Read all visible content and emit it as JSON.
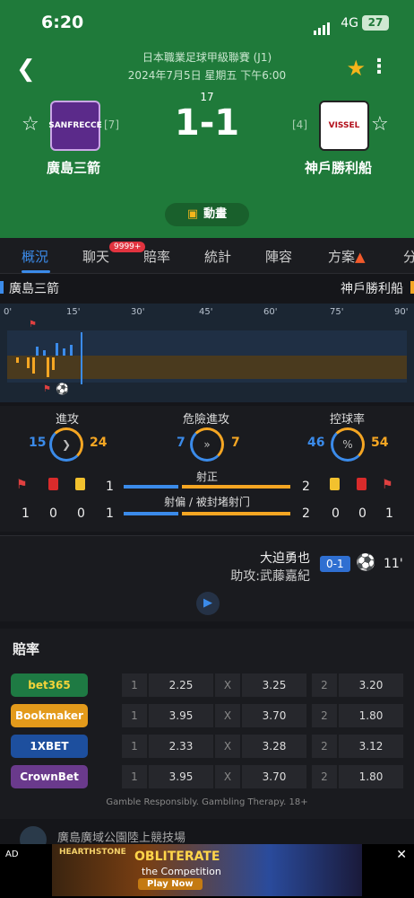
{
  "status": {
    "time": "6:20",
    "network": "4G",
    "battery": "27"
  },
  "header": {
    "league": "日本職業足球甲級聯賽 (J1)",
    "datetime": "2024年7月5日 星期五 下午6:00",
    "round": "17",
    "score": "1-1",
    "home": {
      "name": "廣島三箭",
      "rank": "[7]",
      "logo_text": "SANFRECCE"
    },
    "away": {
      "name": "神戶勝利船",
      "rank": "[4]",
      "logo_text": "VISSEL"
    },
    "animation_label": "動畫",
    "icons": {
      "back": "chevron-left-icon",
      "favorite": "star-icon",
      "more": "more-vertical-icon"
    }
  },
  "tabs": [
    {
      "label": "概況"
    },
    {
      "label": "聊天"
    },
    {
      "label": "賠率"
    },
    {
      "label": "統計"
    },
    {
      "label": "陣容"
    },
    {
      "label": "方案"
    },
    {
      "label": "分"
    }
  ],
  "chat_badge": "9999+",
  "timeline": {
    "home_name": "廣島三箭",
    "away_name": "神戶勝利船",
    "ticks": [
      "0'",
      "15'",
      "30'",
      "45'",
      "60'",
      "75'",
      "90'"
    ]
  },
  "stats": {
    "attack": {
      "label": "進攻",
      "home": "15",
      "away": "24"
    },
    "dangerous": {
      "label": "危險進攻",
      "home": "7",
      "away": "7"
    },
    "possession": {
      "label": "控球率",
      "home": "46",
      "away": "54"
    },
    "home_cards": {
      "corners": "1",
      "red": "0",
      "yellow": "0"
    },
    "away_cards": {
      "corners": "1",
      "red": "0",
      "yellow": "0"
    },
    "shots_on": {
      "label": "射正",
      "home": "1",
      "away": "2"
    },
    "shots_off": {
      "label": "射偏 / 被封堵射门",
      "home": "1",
      "away": "2"
    }
  },
  "goal_event": {
    "scorer": "大迫勇也",
    "assist": "助攻:武藤嘉紀",
    "score": "0-1",
    "minute": "11'"
  },
  "odds": {
    "title": "賠率",
    "rows": [
      {
        "bookmaker": "bet365",
        "color": "#1e7a43",
        "text_color": "#f2d33a",
        "h_lbl": "1",
        "home": "2.25",
        "d_lbl": "X",
        "draw": "3.25",
        "a_lbl": "2",
        "away": "3.20"
      },
      {
        "bookmaker": "Bookmaker",
        "color": "#e39a1b",
        "text_color": "#ffffff",
        "h_lbl": "1",
        "home": "3.95",
        "d_lbl": "X",
        "draw": "3.70",
        "a_lbl": "2",
        "away": "1.80"
      },
      {
        "bookmaker": "1XBET",
        "color": "#1d4f9e",
        "text_color": "#ffffff",
        "h_lbl": "1",
        "home": "2.33",
        "d_lbl": "X",
        "draw": "3.28",
        "a_lbl": "2",
        "away": "3.12"
      },
      {
        "bookmaker": "CrownBet",
        "color": "#6a3a8c",
        "text_color": "#ffffff",
        "h_lbl": "1",
        "home": "3.95",
        "d_lbl": "X",
        "draw": "3.70",
        "a_lbl": "2",
        "away": "1.80"
      }
    ],
    "responsible": "Gamble Responsibly. Gambling Therapy. 18+"
  },
  "news_title": "廣島廣域公園陸上競技場",
  "ad": {
    "label": "AD",
    "close": "✕",
    "game": "HEARTHSTONE",
    "title": "OBLITERATE",
    "subtitle": "the Competition",
    "button": "Play Now"
  }
}
